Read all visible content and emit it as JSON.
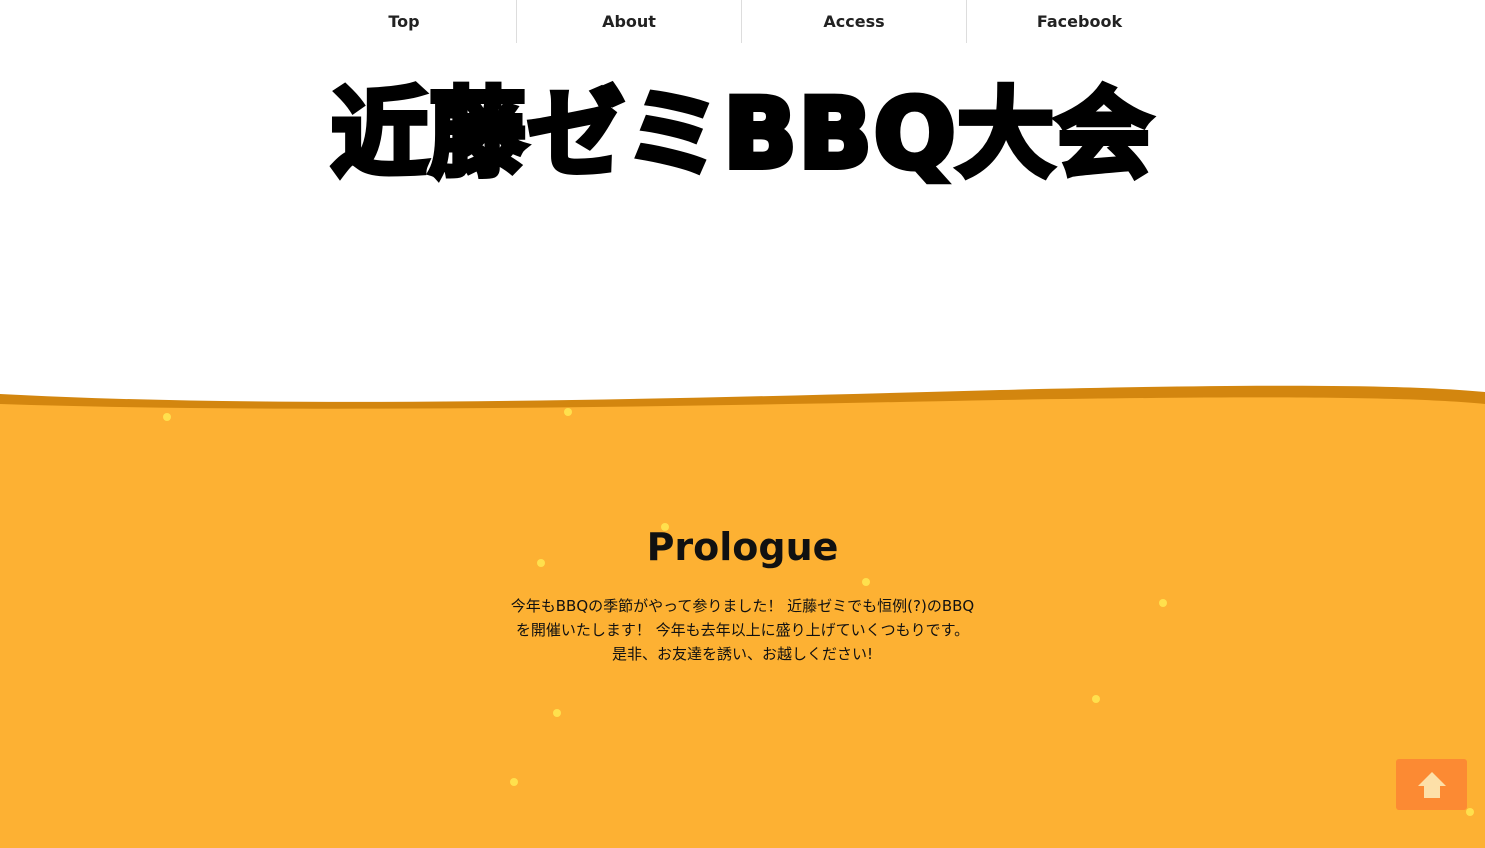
{
  "nav": {
    "items": [
      {
        "label": "Top"
      },
      {
        "label": "About"
      },
      {
        "label": "Access"
      },
      {
        "label": "Facebook"
      }
    ]
  },
  "header": {
    "logo_text": "近藤ゼミBBQ大会"
  },
  "prologue": {
    "heading": "Prologue",
    "body": "今年もBBQの季節がやって参りました！ 近藤ゼミでも恒例(?)のBBQを開催いたします！ 今年も去年以上に盛り上げていくつもりです。 是非、お友達を誘い、お越しください!"
  },
  "icons": {
    "back_to_top": "arrow-up-icon"
  },
  "colors": {
    "orange": "#fdb133",
    "wave_edge": "#d3860f",
    "sparkle": "#ffe04d",
    "button": "#fc8a33",
    "button_icon": "#fde0a8"
  }
}
